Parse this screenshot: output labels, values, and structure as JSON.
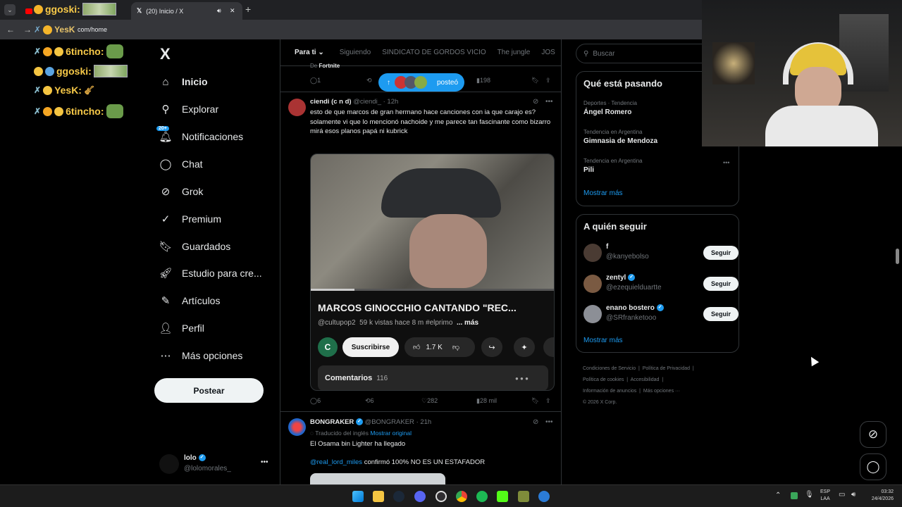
{
  "browser": {
    "tab_active_title": "(20) Inicio / X",
    "tab_other_title": "",
    "address": "com/home",
    "new_tab": "+",
    "close_tab": "✕"
  },
  "overlay_chat": [
    {
      "user": "6tincho:"
    },
    {
      "user": "ggoski:"
    },
    {
      "user": "YesK:"
    },
    {
      "user": "6tincho:"
    }
  ],
  "overlay_top_user": "ggoski:",
  "overlay_addr_user": "YesK",
  "nav": {
    "logo": "X",
    "items": [
      "Inicio",
      "Explorar",
      "Notificaciones",
      "Chat",
      "Grok",
      "Premium",
      "Guardados",
      "Estudio para cre...",
      "Artículos",
      "Perfil",
      "Más opciones"
    ],
    "notif_badge": "20+",
    "post_button": "Postear",
    "account_name": "lolo",
    "account_handle": "@lolomorales_",
    "account_more": "•••"
  },
  "feed": {
    "tabs": [
      "Para ti",
      "Siguiendo",
      "SINDICATO DE GORDOS VICIO",
      "The jungle",
      "JOS"
    ],
    "prev_post": {
      "subtitle_prefix": "De",
      "subtitle": "Fortnite",
      "replies": "1",
      "views": "198",
      "posted_pill": "posteó"
    },
    "post1": {
      "name": "ciendi (c n d)",
      "handle": "@ciendi_",
      "time": "· 12h",
      "text1": "esto de que marcos de gran hermano hace canciones con ia que carajo es?",
      "text2": "solamente vi que lo mencionó nachoide y me parece tan fascinante como bizarro",
      "text3": "mirá esos planos papá ni kubrick",
      "video_title": "MARCOS GINOCCHIO CANTANDO \"REC...",
      "channel": "@cultupop2",
      "video_meta": "59 k vistas  hace 8 m  #elprimo",
      "more": "... más",
      "channel_initial": "C",
      "subscribe": "Suscribirse",
      "likes": "1.7 K",
      "comments_label": "Comentarios",
      "comments_count": "116",
      "replies": "6",
      "reposts": "6",
      "likes_x": "282",
      "views": "28 mil"
    },
    "post2": {
      "name": "BONGRAKER",
      "handle": "@BONGRAKER",
      "time": "· 21h",
      "translated": "Traducido del inglés",
      "show_original": "Mostrar original",
      "text1": "El Osama bin Lighter ha llegado",
      "mention": "@real_lord_miles",
      "text2": " confirmó 100% NO ES UN ESTAFADOR"
    }
  },
  "right": {
    "search_placeholder": "Buscar",
    "trends_title": "Qué está pasando",
    "trends": [
      {
        "context": "Deportes · Tendencia",
        "name": "Ángel Romero"
      },
      {
        "context": "Tendencia en Argentina",
        "name": "Gimnasia de Mendoza"
      },
      {
        "context": "Tendencia en Argentina",
        "name": "Pili"
      }
    ],
    "show_more": "Mostrar más",
    "follow_title": "A quién seguir",
    "follow": [
      {
        "name": "f",
        "handle": "@kanyebolso"
      },
      {
        "name": "zentyl",
        "handle": "@ezequielduartte"
      },
      {
        "name": "enano bostero",
        "handle": "@SRfranketooo"
      }
    ],
    "follow_btn": "Seguir",
    "show_more2": "Mostrar más",
    "footer": [
      "Condiciones de Servicio",
      "Política de Privacidad",
      "Política de cookies",
      "Accesibilidad",
      "Información de anuncios",
      "Más opciones ···",
      "© 2026 X Corp."
    ]
  },
  "taskbar": {
    "lang1": "ESP",
    "lang2": "LAA",
    "time": "03:32",
    "date": "24/4/2026"
  },
  "colors": {
    "accent": "#1d9bf0",
    "bg": "#000000",
    "muted": "#71767b"
  }
}
